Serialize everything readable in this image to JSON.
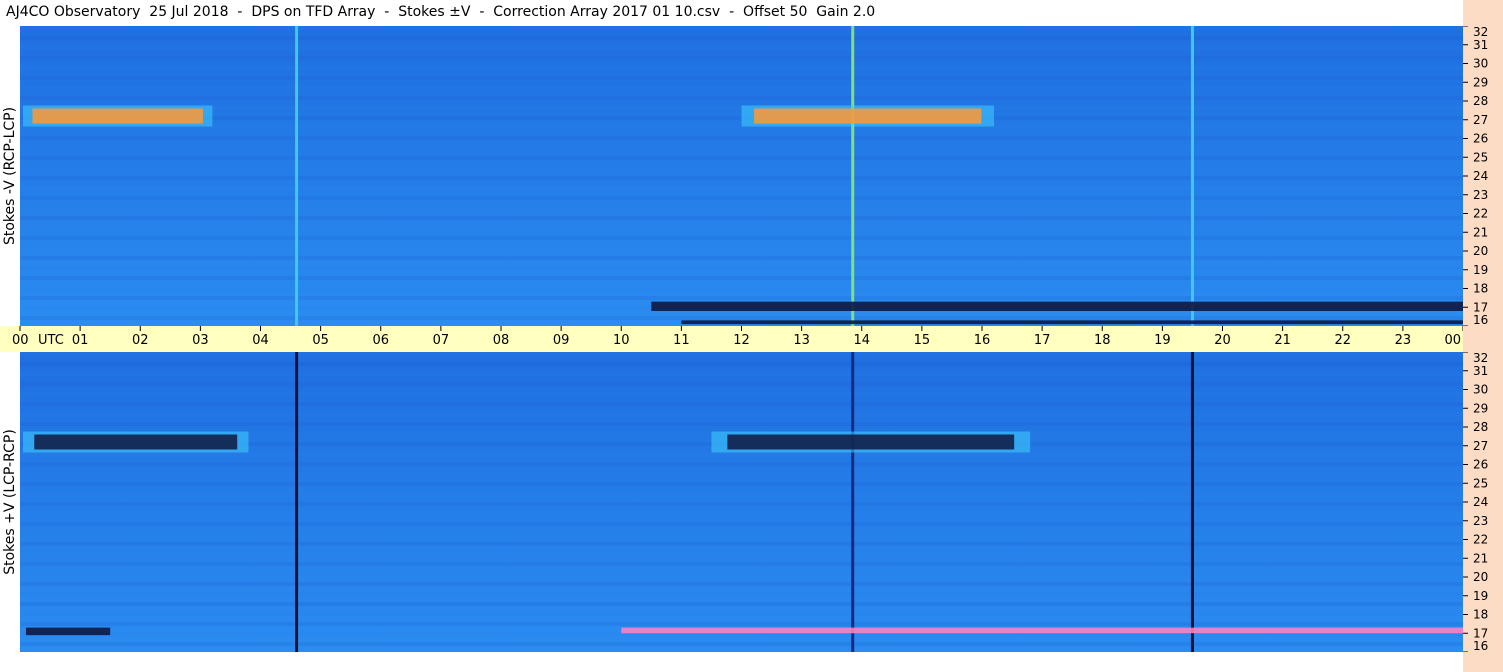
{
  "title": "AJ4CO Observatory  25 Jul 2018  -  DPS on TFD Array  -  Stokes ±V  -  Correction Array 2017 01 10.csv  -  Offset 50  Gain 2.0",
  "chart_data": [
    {
      "type": "heatmap",
      "panel": "top",
      "ylabel": "Stokes -V (RCP-LCP)",
      "x_axis": {
        "ticks": [
          "00",
          "01",
          "02",
          "03",
          "04",
          "05",
          "06",
          "07",
          "08",
          "09",
          "10",
          "11",
          "12",
          "13",
          "14",
          "15",
          "16",
          "17",
          "18",
          "19",
          "20",
          "21",
          "22",
          "23",
          "00"
        ],
        "unit_label": "UTC",
        "range_hours": [
          0,
          24
        ]
      },
      "y_axis": {
        "ticks": [
          "16",
          "17",
          "18",
          "19",
          "20",
          "21",
          "22",
          "23",
          "24",
          "25",
          "26",
          "27",
          "28",
          "29",
          "30",
          "31",
          "32"
        ],
        "unit_label": "MHz",
        "range_mhz": [
          16,
          32
        ]
      },
      "features": [
        {
          "kind": "vertical_line",
          "hour": 4.6,
          "color": "#40c8ff"
        },
        {
          "kind": "vertical_line",
          "hour": 19.5,
          "color": "#40c8ff"
        },
        {
          "kind": "vertical_line",
          "hour": 13.85,
          "color": "#80e080"
        },
        {
          "kind": "burst",
          "hours": [
            0.05,
            3.2
          ],
          "mhz": [
            26.8,
            27.6
          ],
          "color": "#ff9933"
        },
        {
          "kind": "burst",
          "hours": [
            12.0,
            16.2
          ],
          "mhz": [
            26.8,
            27.6
          ],
          "color": "#ff9933"
        },
        {
          "kind": "band",
          "hours": [
            10.5,
            24
          ],
          "mhz": [
            16.8,
            17.3
          ],
          "color": "#101840"
        },
        {
          "kind": "band",
          "hours": [
            11.0,
            24
          ],
          "mhz": [
            16.1,
            16.3
          ],
          "color": "#101840"
        }
      ]
    },
    {
      "type": "heatmap",
      "panel": "bottom",
      "ylabel": "Stokes +V (LCP-RCP)",
      "x_axis": {
        "ticks": [
          "00",
          "01",
          "02",
          "03",
          "04",
          "05",
          "06",
          "07",
          "08",
          "09",
          "10",
          "11",
          "12",
          "13",
          "14",
          "15",
          "16",
          "17",
          "18",
          "19",
          "20",
          "21",
          "22",
          "23",
          "00"
        ],
        "unit_label": "UTC",
        "range_hours": [
          0,
          24
        ]
      },
      "y_axis": {
        "ticks": [
          "16",
          "17",
          "18",
          "19",
          "20",
          "21",
          "22",
          "23",
          "24",
          "25",
          "26",
          "27",
          "28",
          "29",
          "30",
          "31",
          "32"
        ],
        "unit_label": "MHz",
        "range_mhz": [
          16,
          32
        ]
      },
      "features": [
        {
          "kind": "vertical_line",
          "hour": 4.6,
          "color": "#101030"
        },
        {
          "kind": "vertical_line",
          "hour": 19.5,
          "color": "#101030"
        },
        {
          "kind": "vertical_line",
          "hour": 13.85,
          "color": "#1a2a80"
        },
        {
          "kind": "burst",
          "hours": [
            0.05,
            3.8
          ],
          "mhz": [
            26.8,
            27.6
          ],
          "color": "#101840"
        },
        {
          "kind": "burst",
          "hours": [
            11.5,
            16.8
          ],
          "mhz": [
            26.8,
            27.6
          ],
          "color": "#101840"
        },
        {
          "kind": "band",
          "hours": [
            10.0,
            24
          ],
          "mhz": [
            17.0,
            17.3
          ],
          "color": "#ff80c0"
        },
        {
          "kind": "band",
          "hours": [
            0.1,
            1.5
          ],
          "mhz": [
            16.9,
            17.3
          ],
          "color": "#101840"
        }
      ]
    }
  ],
  "colors": {
    "panel_background": "#1f6fe0",
    "panel_background_light": "#2a8cf0",
    "time_axis_background": "#ffffc0",
    "freq_axis_background": "#fcdcc4"
  }
}
